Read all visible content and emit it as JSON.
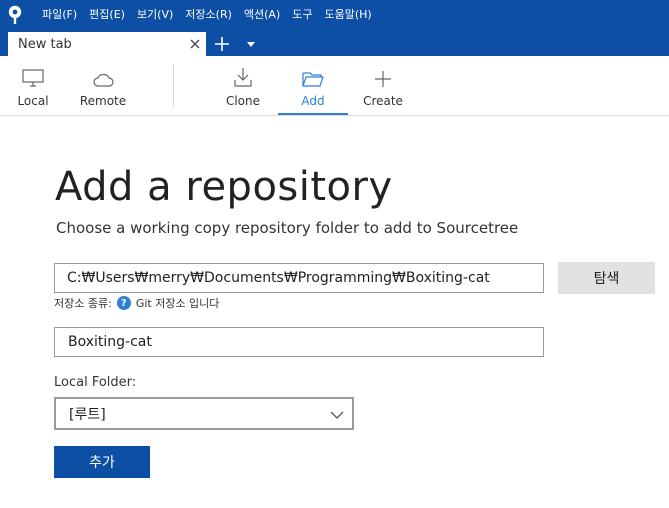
{
  "menubar": {
    "items": [
      "파일(F)",
      "편집(E)",
      "보기(V)",
      "저장소(R)",
      "액션(A)",
      "도구",
      "도움말(H)"
    ]
  },
  "tabs": {
    "active_tab_label": "New tab"
  },
  "toolbar": {
    "items": [
      {
        "label": "Local",
        "icon": "monitor-icon"
      },
      {
        "label": "Remote",
        "icon": "cloud-icon"
      },
      {
        "label": "Clone",
        "icon": "download-icon"
      },
      {
        "label": "Add",
        "icon": "folder-icon"
      },
      {
        "label": "Create",
        "icon": "plus-icon"
      }
    ],
    "active": "Add"
  },
  "main": {
    "title": "Add a repository",
    "subtitle": "Choose a working copy repository folder to add to Sourcetree",
    "path_value": "C:₩Users₩merry₩Documents₩Programming₩Boxiting-cat",
    "browse_label": "탐색",
    "repo_type_label": "저장소 종류:",
    "repo_type_value": "Git 저장소 입니다",
    "name_value": "Boxiting-cat",
    "local_folder_label": "Local Folder:",
    "local_folder_value": "[루트]",
    "add_label": "추가"
  },
  "colors": {
    "brand": "#0e4fa6",
    "accent": "#2f80d1",
    "button_gray": "#e1e1e1"
  }
}
